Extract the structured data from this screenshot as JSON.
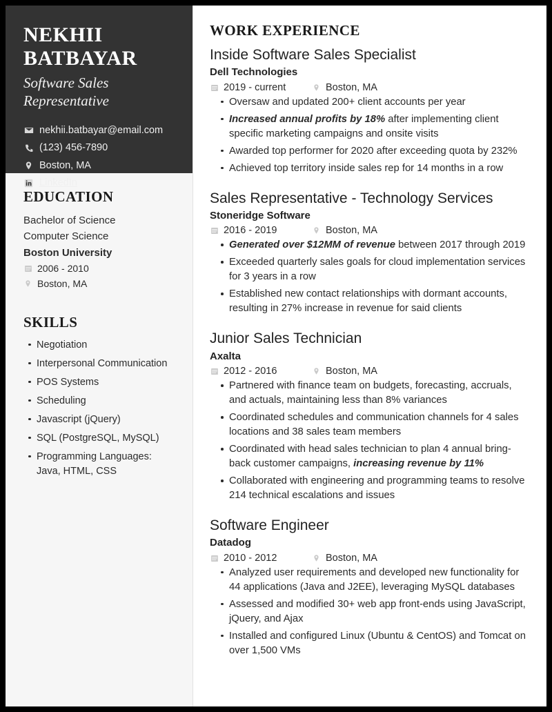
{
  "theme": {
    "frame_color": "#000000",
    "header_bg": "#333333",
    "sidebar_bg": "#f6f6f6",
    "page_bg": "#ffffff",
    "text_color": "#2b2b2b",
    "icon_color": "#c9c9c9"
  },
  "sidebar": {
    "name_lines": [
      "NEKHII",
      "BATBAYAR"
    ],
    "job_title_lines": [
      "Software Sales",
      "Representative"
    ],
    "contact": [
      {
        "icon": "email-icon",
        "text": "nekhii.batbayar@email.com",
        "link": false
      },
      {
        "icon": "phone-icon",
        "text": "(123) 456-7890",
        "link": false
      },
      {
        "icon": "location-icon",
        "text": "Boston, MA",
        "link": false
      },
      {
        "icon": "linkedin-icon",
        "text": "LinkedIn",
        "link": true
      }
    ],
    "education": {
      "title": "EDUCATION",
      "degree": "Bachelor of Science",
      "field": "Computer Science",
      "school": "Boston University",
      "dates": "2006 - 2010",
      "location": "Boston, MA"
    },
    "skills": {
      "title": "SKILLS",
      "items": [
        "Negotiation",
        "Interpersonal Communication",
        "POS Systems",
        "Scheduling",
        "Javascript (jQuery)",
        "SQL (PostgreSQL, MySQL)",
        "Programming Languages: Java, HTML, CSS"
      ]
    }
  },
  "main": {
    "section_title": "WORK EXPERIENCE",
    "jobs": [
      {
        "title": "Inside Software Sales Specialist",
        "company": "Dell Technologies",
        "dates": "2019 - current",
        "location": "Boston, MA",
        "bullets": [
          {
            "pre": "",
            "highlight": "",
            "post": "Oversaw and updated 200+ client accounts per year"
          },
          {
            "pre": "",
            "highlight": "Increased annual profits by 18%",
            "post": " after implementing client specific marketing campaigns and onsite visits"
          },
          {
            "pre": "",
            "highlight": "",
            "post": "Awarded top performer for 2020 after exceeding quota by 232%"
          },
          {
            "pre": "",
            "highlight": "",
            "post": "Achieved top territory inside sales rep for 14 months in a row"
          }
        ]
      },
      {
        "title": "Sales Representative - Technology Services",
        "company": "Stoneridge Software",
        "dates": "2016 - 2019",
        "location": "Boston, MA",
        "bullets": [
          {
            "pre": "",
            "highlight": "Generated over $12MM of revenue",
            "post": " between 2017 through 2019"
          },
          {
            "pre": "",
            "highlight": "",
            "post": "Exceeded quarterly sales goals for cloud implementation services for 3 years in a row"
          },
          {
            "pre": "",
            "highlight": "",
            "post": "Established new contact relationships with dormant accounts, resulting in 27% increase in revenue for said clients"
          }
        ]
      },
      {
        "title": "Junior Sales Technician",
        "company": "Axalta",
        "dates": "2012 - 2016",
        "location": "Boston, MA",
        "bullets": [
          {
            "pre": "",
            "highlight": "",
            "post": "Partnered with finance team on budgets, forecasting, accruals, and actuals, maintaining less than 8% variances"
          },
          {
            "pre": "",
            "highlight": "",
            "post": "Coordinated schedules and communication channels for 4 sales locations and 38 sales team members"
          },
          {
            "pre": "Coordinated with head sales technician to plan 4 annual bring-back customer campaigns, ",
            "highlight": "increasing revenue by 11%",
            "post": ""
          },
          {
            "pre": "",
            "highlight": "",
            "post": "Collaborated with engineering and programming teams to resolve 214 technical escalations and issues"
          }
        ]
      },
      {
        "title": "Software Engineer",
        "company": "Datadog",
        "dates": "2010 - 2012",
        "location": "Boston, MA",
        "bullets": [
          {
            "pre": "",
            "highlight": "",
            "post": "Analyzed user requirements and developed new functionality for 44 applications (Java and J2EE), leveraging MySQL databases"
          },
          {
            "pre": "",
            "highlight": "",
            "post": "Assessed and modified 30+ web app front-ends using JavaScript, jQuery, and Ajax"
          },
          {
            "pre": "",
            "highlight": "",
            "post": "Installed and configured Linux (Ubuntu & CentOS) and Tomcat on over 1,500 VMs"
          }
        ]
      }
    ]
  }
}
